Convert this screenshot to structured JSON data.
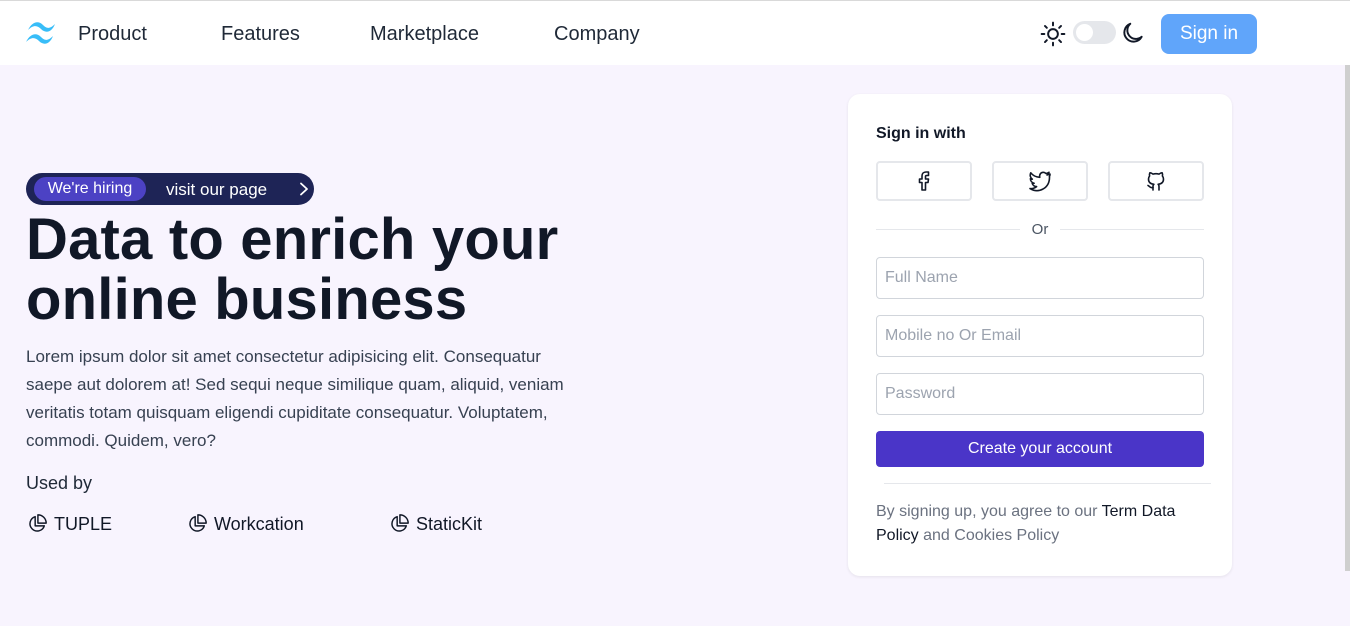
{
  "nav": {
    "links": [
      "Product",
      "Features",
      "Marketplace",
      "Company"
    ],
    "sign_in_label": "Sign in",
    "logo_color": "#38bdf8",
    "theme_toggle": {
      "state": "off"
    }
  },
  "hero": {
    "hiring_tag": "We're hiring",
    "hiring_link": "visit our page",
    "headline_line1": "Data to enrich your",
    "headline_line2": "online business",
    "description": "Lorem ipsum dolor sit amet consectetur adipisicing elit. Consequatur saepe aut dolorem at! Sed sequi neque similique quam, aliquid, veniam veritatis totam quisquam eligendi cupiditate consequatur. Voluptatem, commodi. Quidem, vero?",
    "used_by_label": "Used by",
    "brands": [
      "TUPLE",
      "Workcation",
      "StaticKit"
    ]
  },
  "signup": {
    "title": "Sign in with",
    "social": [
      "facebook-icon",
      "twitter-icon",
      "github-icon"
    ],
    "divider": "Or",
    "fields": {
      "full_name_placeholder": "Full Name",
      "contact_placeholder": "Mobile no Or Email",
      "password_placeholder": "Password"
    },
    "submit_label": "Create your account",
    "terms_prefix": "By signing up, you agree to our ",
    "terms_link": "Term Data Policy",
    "terms_mid": " and ",
    "cookies_link": "Cookies Policy"
  },
  "colors": {
    "background": "#f8f4fe",
    "accent": "#4a35c8",
    "sign_in_button": "#60a5fa",
    "hiring_pill": "#1e2456"
  }
}
